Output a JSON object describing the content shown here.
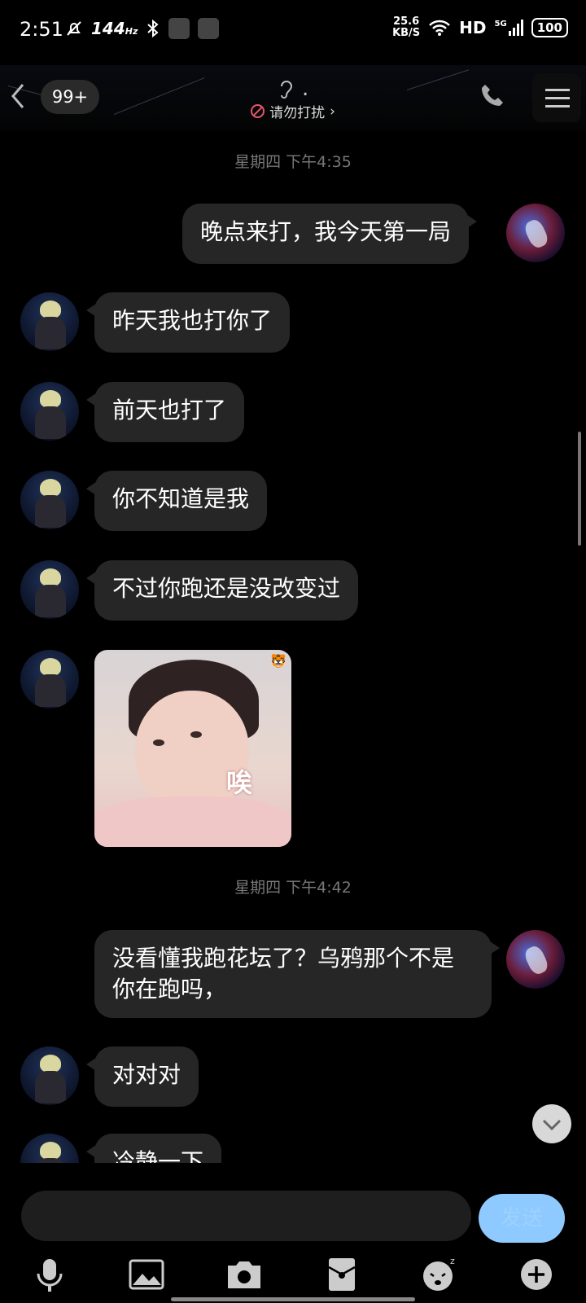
{
  "status_bar": {
    "time": "2:51",
    "refresh_rate": "144",
    "refresh_unit": "Hz",
    "net_speed": "25.6",
    "net_unit": "KB/S",
    "network": "HD",
    "signal": "5G",
    "battery": "100"
  },
  "header": {
    "unread_badge": "99+",
    "title_suffix": ".",
    "dnd_label": "请勿打扰",
    "dnd_chevron": "›"
  },
  "chat": {
    "timestamps": [
      "星期四 下午4:35",
      "星期四 下午4:42"
    ],
    "messages": [
      {
        "from": "self",
        "text": "晚点来打，我今天第一局"
      },
      {
        "from": "other",
        "text": "昨天我也打你了"
      },
      {
        "from": "other",
        "text": "前天也打了"
      },
      {
        "from": "other",
        "text": "你不知道是我"
      },
      {
        "from": "other",
        "text": "不过你跑还是没改变过"
      },
      {
        "from": "other",
        "type": "sticker",
        "text": "唉"
      },
      {
        "from": "self",
        "text": "没看懂我跑花坛了？乌鸦那个不是你在跑吗，"
      },
      {
        "from": "other",
        "text": "对对对"
      },
      {
        "from": "other",
        "text": "冷静一下"
      }
    ]
  },
  "input": {
    "value": "",
    "send_label": "发送"
  },
  "toolbar": {
    "items": [
      "microphone-icon",
      "image-icon",
      "camera-icon",
      "red-packet-icon",
      "emoji-icon",
      "plus-icon"
    ]
  },
  "colors": {
    "background": "#000000",
    "bubble": "#262626",
    "send_button": "#8ecaff",
    "dnd_icon": "#e5566a"
  }
}
